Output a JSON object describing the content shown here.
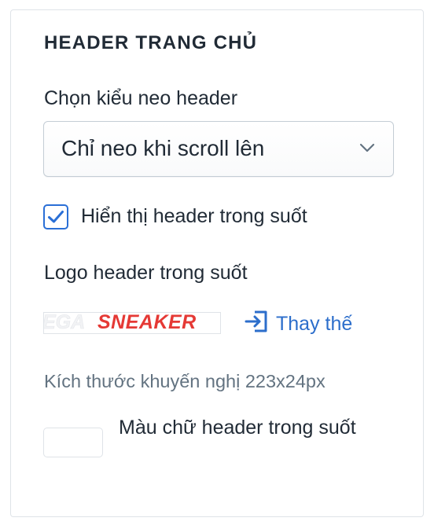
{
  "section": {
    "title": "HEADER TRANG CHỦ"
  },
  "sticky": {
    "label": "Chọn kiểu neo header",
    "selected": "Chỉ neo khi scroll lên"
  },
  "transparent": {
    "checkbox_label": "Hiển thị header trong suốt",
    "checked": true
  },
  "logo": {
    "label": "Logo header trong suốt",
    "image_text_faded": "EGA",
    "image_text": "SNEAKER",
    "replace_label": "Thay thế",
    "hint": "Kích thước khuyến nghị 223x24px"
  },
  "text_color": {
    "label": "Màu chữ header trong suốt",
    "value": "#ffffff"
  },
  "colors": {
    "accent": "#2c6ecb",
    "logo_red": "#e53935",
    "hint": "#637381"
  }
}
